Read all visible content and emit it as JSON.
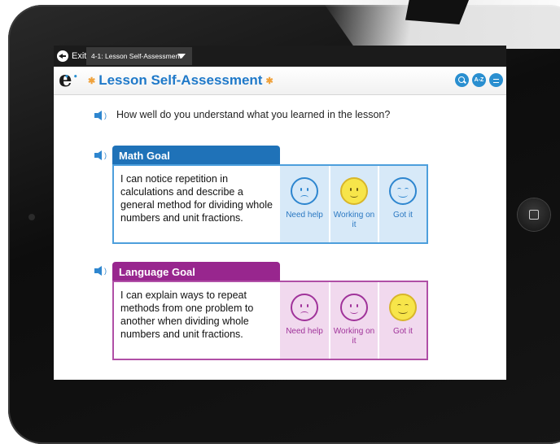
{
  "topbar": {
    "exit_label": "Exit",
    "lesson_selector": "4-1: Lesson Self-Assessment"
  },
  "titlebar": {
    "logo": "e",
    "title": "Lesson Self-Assessment",
    "tools": [
      "search-icon",
      "A-Z",
      "menu-icon"
    ],
    "az_label": "A-Z"
  },
  "question": "How well do you understand what you learned in the lesson?",
  "goals": [
    {
      "heading": "Math Goal",
      "text": "I can notice repetition in calculations and describe a general method for dividing whole numbers and unit fractions.",
      "choices": [
        "Need help",
        "Working on it",
        "Got it"
      ],
      "selected": "Working on it",
      "color": "#1f72b8"
    },
    {
      "heading": "Language Goal",
      "text": "I can explain ways to repeat methods from one problem to another when dividing whole numbers and unit fractions.",
      "choices": [
        "Need help",
        "Working on it",
        "Got it"
      ],
      "selected": "Got it",
      "color": "#98268e"
    }
  ],
  "colors": {
    "accent_blue": "#2e86cf",
    "title_blue": "#1f79c9",
    "purple": "#98268e",
    "selected_face": "#f7e54a"
  }
}
